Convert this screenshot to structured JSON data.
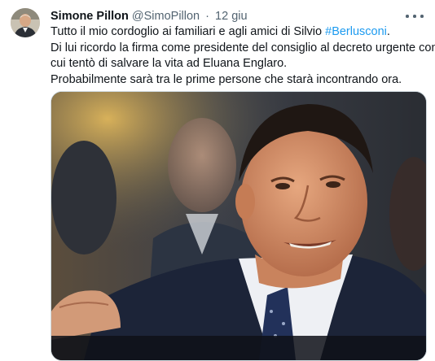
{
  "author": {
    "name": "Simone Pillon",
    "handle": "@SimoPillon",
    "separator": "·",
    "time": "12 giu"
  },
  "tweet": {
    "line1_prefix": "Tutto il mio cordoglio ai familiari e agli amici di Silvio ",
    "hashtag": "#Berlusconi",
    "line1_suffix": ".",
    "line2": "Di lui ricordo la firma come presidente del consiglio al decreto urgente con",
    "line3": "cui tentò di salvare la vita ad Eluana Englaro.",
    "line4": "Probabilmente sarà tra le prime persone che starà incontrando ora."
  },
  "colors": {
    "text": "#0f1419",
    "secondary": "#536471",
    "link": "#1d9bf0",
    "border": "#cfd9de"
  },
  "icons": {
    "more": "more-horizontal-icon",
    "avatar": "user-avatar"
  }
}
